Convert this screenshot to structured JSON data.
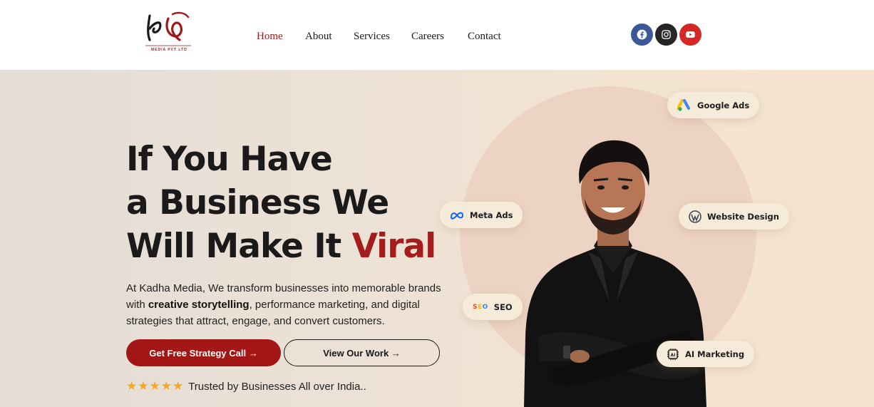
{
  "header": {
    "logo_mark": "కథ",
    "logo_sub": "MEDIA PVT LTD",
    "nav": [
      {
        "label": "Home",
        "active": true
      },
      {
        "label": "About",
        "active": false
      },
      {
        "label": "Services",
        "active": false
      },
      {
        "label": "Careers",
        "active": false
      },
      {
        "label": "Contact",
        "active": false
      }
    ],
    "social": [
      {
        "icon": "facebook-icon",
        "color": "#3b5998"
      },
      {
        "icon": "instagram-icon",
        "color": "#262626"
      },
      {
        "icon": "youtube-icon",
        "color": "#d62727"
      }
    ]
  },
  "hero": {
    "headline_line1": "If You Have",
    "headline_line2": "a Business We",
    "headline_line3_prefix": "Will Make It ",
    "headline_line3_accent": "Viral",
    "desc_part1": "At Kadha Media, We transform businesses into memorable brands with ",
    "desc_bold": "creative storytelling",
    "desc_part2": ", performance marketing, and digital strategies that attract, engage, and convert customers.",
    "cta_primary": "Get Free Strategy Call →",
    "cta_secondary": "View Our Work →",
    "stars": "★★★★★",
    "trust_text": "Trusted by Businesses All over India.."
  },
  "badges": [
    {
      "id": "google-ads",
      "label": "Google Ads",
      "icon": "google-ads-icon"
    },
    {
      "id": "meta-ads",
      "label": "Meta Ads",
      "icon": "meta-icon"
    },
    {
      "id": "website-design",
      "label": "Website Design",
      "icon": "wordpress-icon"
    },
    {
      "id": "seo",
      "label": "SEO",
      "icon": "seo-icon",
      "icon_text": "SEO"
    },
    {
      "id": "ai-marketing",
      "label": "AI Marketing",
      "icon": "ai-chip-icon",
      "icon_text": "AI"
    }
  ],
  "colors": {
    "brand_red": "#a31616",
    "accent_red": "#9c1c1c",
    "star": "#f5a623"
  }
}
